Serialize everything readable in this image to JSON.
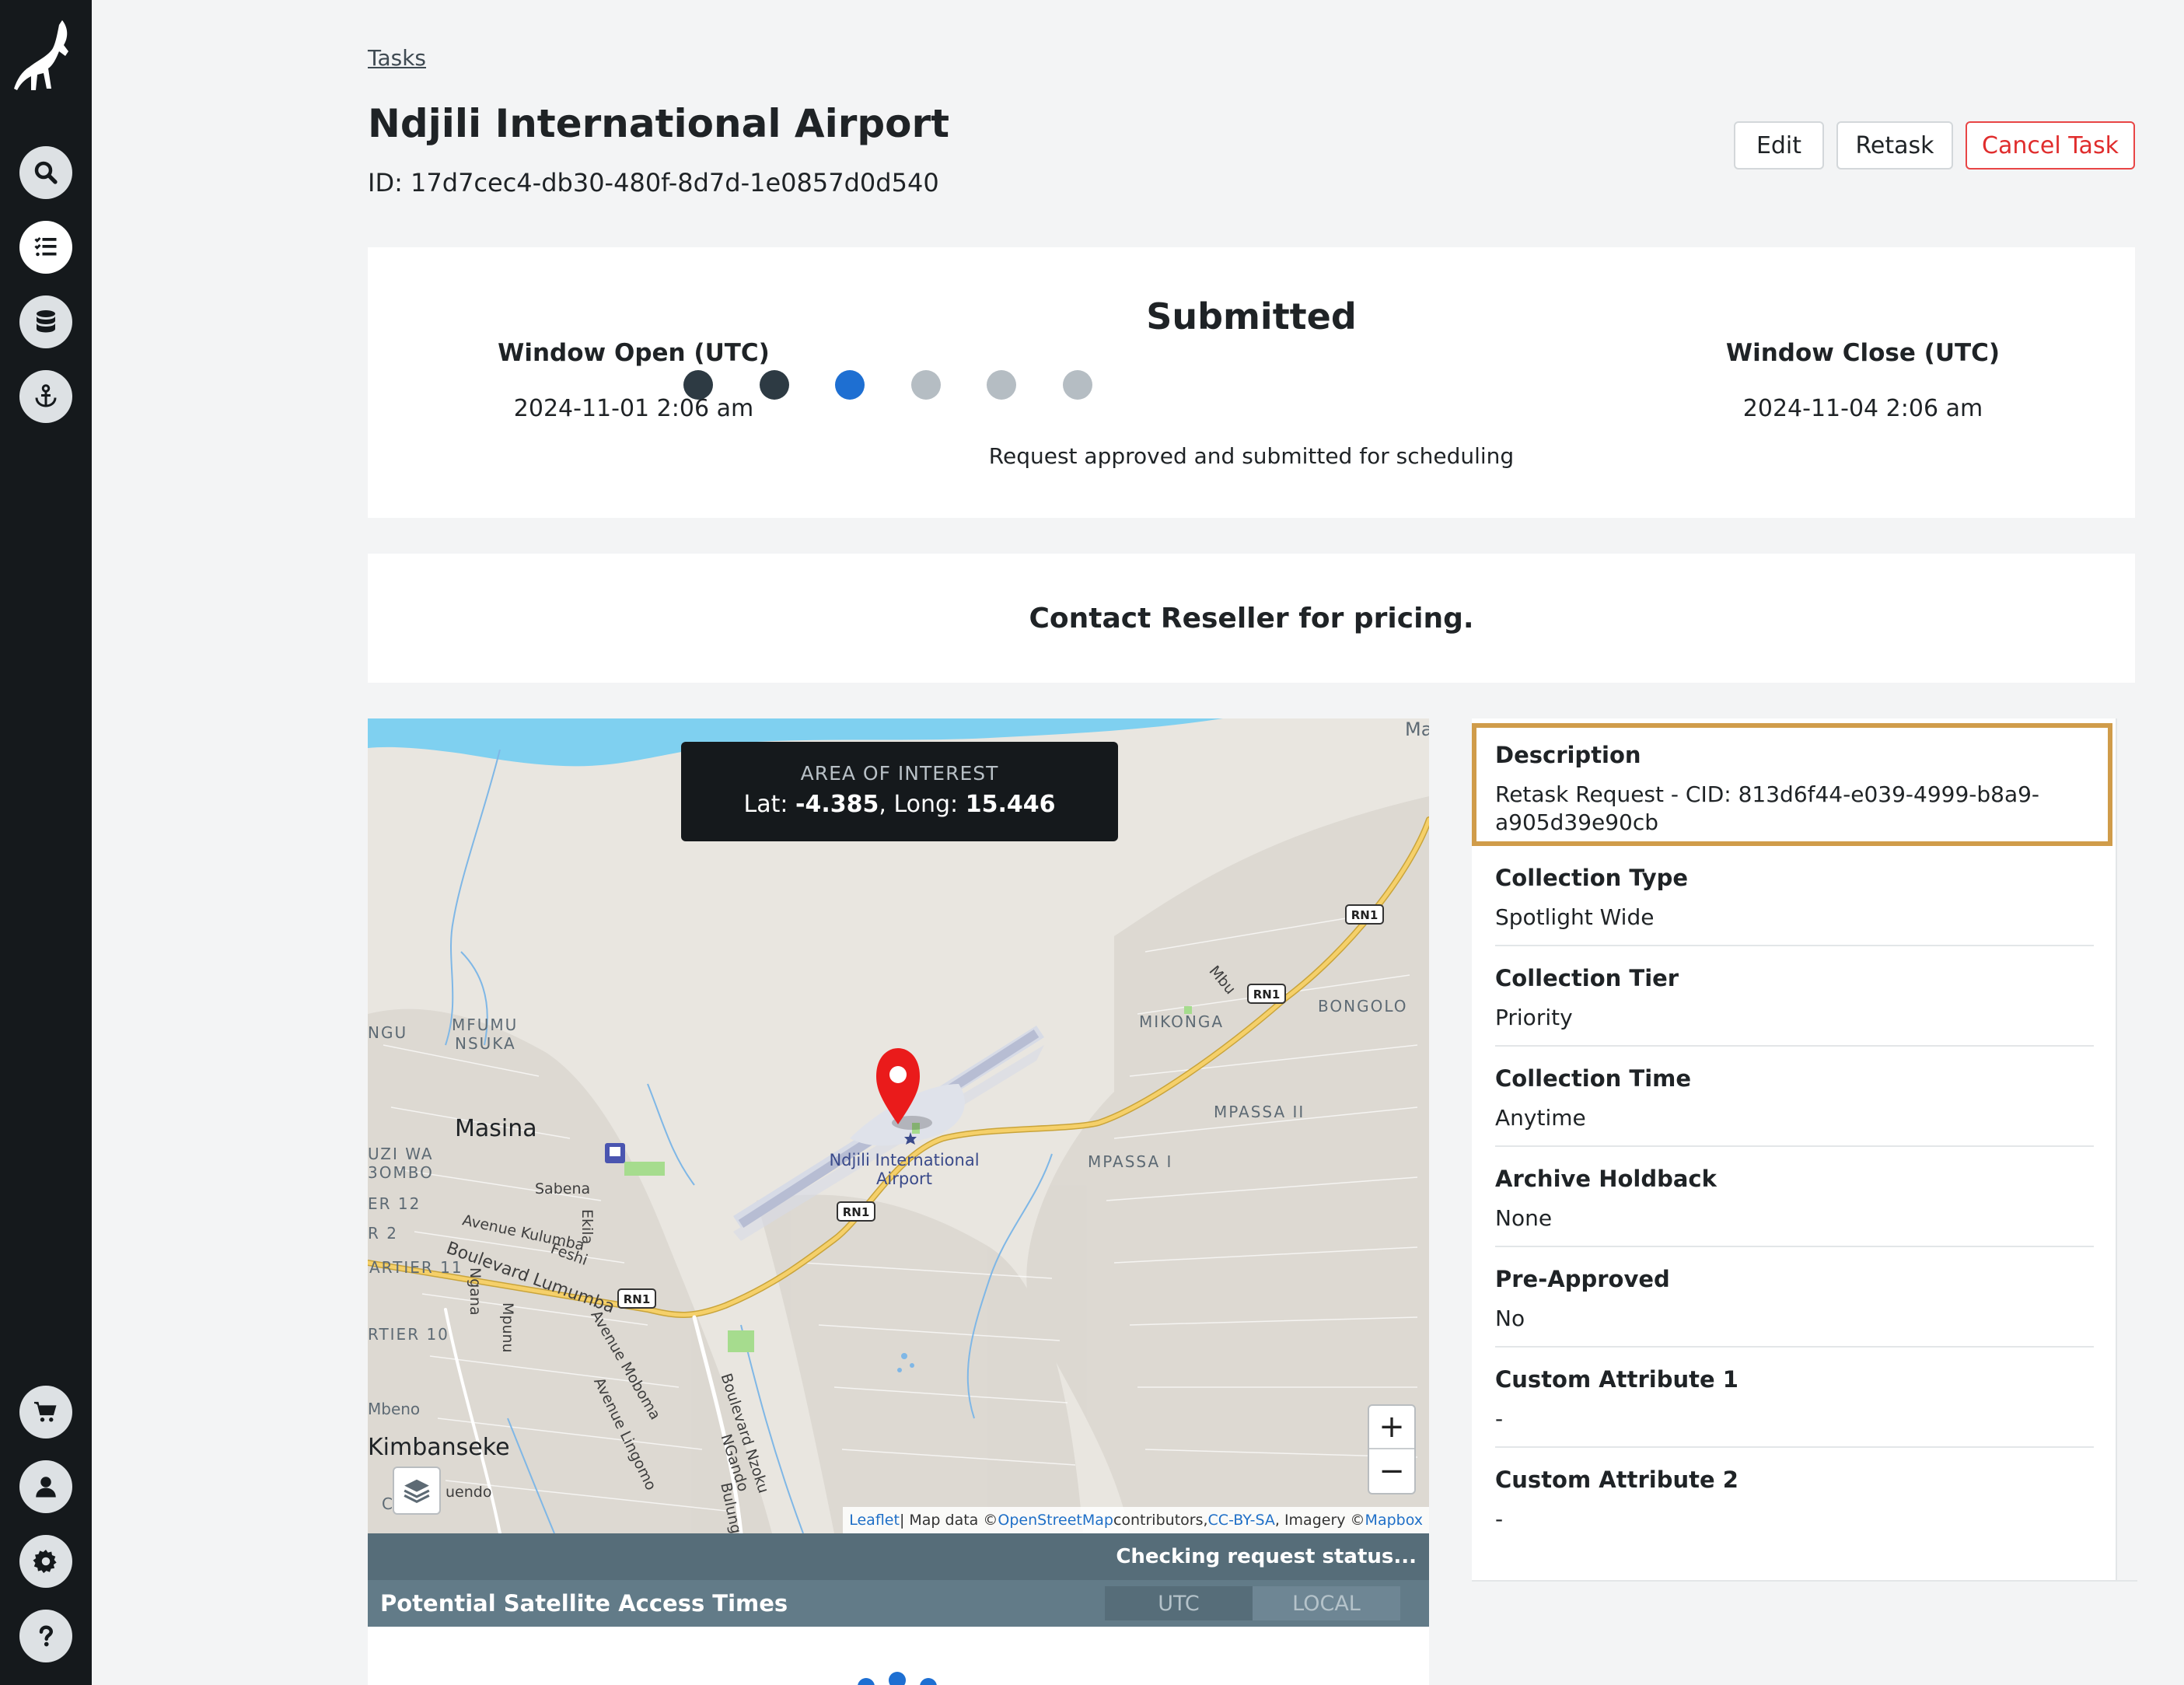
{
  "breadcrumb": {
    "tasks_link": "Tasks"
  },
  "header": {
    "title": "Ndjili International Airport",
    "id_text": "ID: 17d7cec4-db30-480f-8d7d-1e0857d0d540",
    "edit_label": "Edit",
    "retask_label": "Retask",
    "cancel_label": "Cancel Task"
  },
  "sidebar": {
    "icons": [
      "search-icon",
      "task-list-icon",
      "database-icon",
      "anchor-icon",
      "cart-icon",
      "user-icon",
      "gear-icon",
      "help-icon"
    ],
    "active": "task-list-icon"
  },
  "status": {
    "window_open_label": "Window Open (UTC)",
    "window_open_value": "2024-11-01 2:06 am",
    "title": "Submitted",
    "description": "Request approved and submitted for scheduling",
    "window_close_label": "Window Close (UTC)",
    "window_close_value": "2024-11-04 2:06 am",
    "steps_total": 6,
    "current_step": 3,
    "colors": {
      "done": "#2d3a43",
      "current": "#1e6fd2",
      "pending": "#b5bdc3"
    }
  },
  "pricing": {
    "text": "Contact Reseller for pricing."
  },
  "map": {
    "aoi_title": "AREA OF INTEREST",
    "lat_label": "Lat: ",
    "lat_value": "-4.385",
    "long_label": ", Long: ",
    "long_value": "15.446",
    "airport_name_line1": "Ndjili International",
    "airport_name_line2": "Airport",
    "labels": {
      "masina": "Masina",
      "kimbanseke": "Kimbanseke",
      "mfumu": "MFUMU",
      "nsuka": "NSUKA",
      "ngu": "NGU",
      "uzi_wa": "UZI WA",
      "ombo": "3OMBO",
      "er12": "ER 12",
      "r2": "R 2",
      "artier11": "ARTIER 11",
      "rtier10": "RTIER 10",
      "mbeno": "Mbeno",
      "mikonga": "MIKONGA",
      "bongolo": "BONGOLO",
      "mpassa2": "MPASSA II",
      "mpassa1": "MPASSA I",
      "ma": "Ma",
      "sabena": "Sabena",
      "avenue_kulumba": "Avenue Kulumba",
      "feshi": "Feshi",
      "boulevard_lumumba": "Boulevard Lumumba",
      "ekila": "Ekila",
      "ngana": "Ngana",
      "mpunu": "Mpunu",
      "avenue_moboma": "Avenue Moboma",
      "avenue_lingomo": "Avenue Lingomo",
      "boulevard_nzoku": "Boulevard Nzoku",
      "ngando": "NGando",
      "bulungu": "Bulungu",
      "mbu": "Mbu",
      "uendo": "uendo",
      "c": "C",
      "rn1": "RN1"
    },
    "zoom_in": "+",
    "zoom_out": "−",
    "attribution": {
      "leaflet": "Leaflet",
      "sep": " | Map data © ",
      "osm": "OpenStreetMap",
      "contrib": " contributors, ",
      "ccbysa": "CC-BY-SA",
      "imagery": ", Imagery © ",
      "mapbox": "Mapbox"
    }
  },
  "satellite": {
    "checking_text": "Checking request status...",
    "title": "Potential Satellite Access Times",
    "utc_label": "UTC",
    "local_label": "LOCAL"
  },
  "details": {
    "description_label": "Description",
    "description_value": "Retask Request - CID: 813d6f44-e039-4999-b8a9-a905d39e90cb",
    "fields": [
      {
        "label": "Collection Type",
        "value": "Spotlight Wide"
      },
      {
        "label": "Collection Tier",
        "value": "Priority"
      },
      {
        "label": "Collection Time",
        "value": "Anytime"
      },
      {
        "label": "Archive Holdback",
        "value": "None"
      },
      {
        "label": "Pre-Approved",
        "value": "No"
      },
      {
        "label": "Custom Attribute 1",
        "value": "-"
      },
      {
        "label": "Custom Attribute 2",
        "value": "-"
      }
    ],
    "highlight_color": "#d09c4a"
  }
}
